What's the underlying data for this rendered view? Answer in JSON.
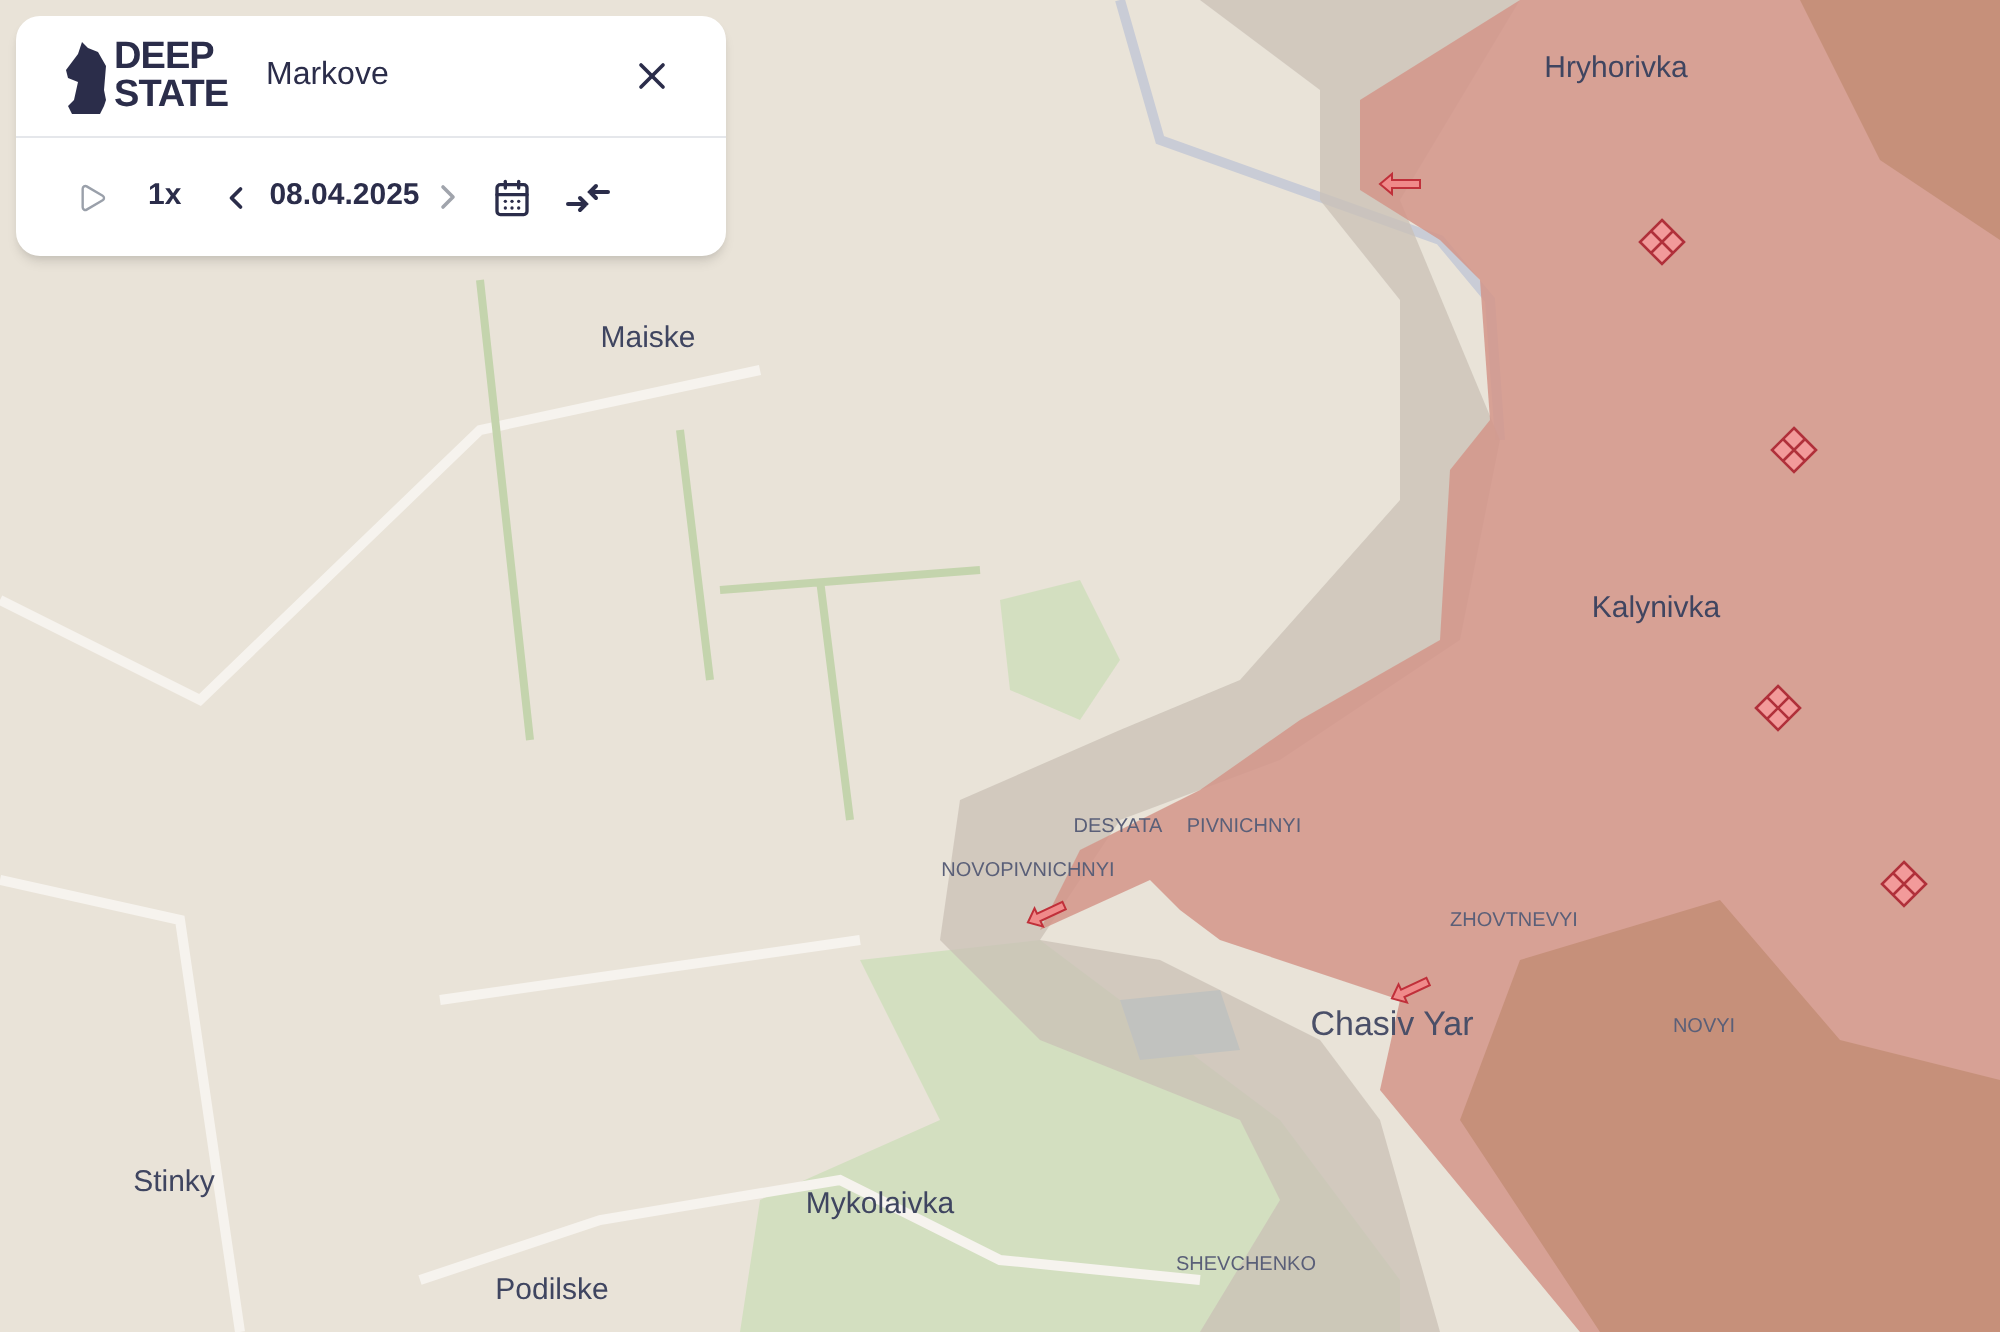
{
  "panel": {
    "logo_lines": [
      "DEEP",
      "STATE"
    ],
    "place": "Markove",
    "speed": "1x",
    "date": "08.04.2025",
    "prev_disabled": false,
    "next_disabled": true
  },
  "map_labels": [
    {
      "text": "Hryhorivka",
      "kind": "town"
    },
    {
      "text": "Maiske",
      "kind": "town"
    },
    {
      "text": "Kalynivka",
      "kind": "town"
    },
    {
      "text": "DESYATA",
      "kind": "district"
    },
    {
      "text": "PIVNICHNYI",
      "kind": "district"
    },
    {
      "text": "NOVOPIVNICHNYI",
      "kind": "district"
    },
    {
      "text": "ZHOVTNEVYI",
      "kind": "district"
    },
    {
      "text": "Chasiv Yar",
      "kind": "city"
    },
    {
      "text": "NOVYI",
      "kind": "district"
    },
    {
      "text": "Stinky",
      "kind": "town"
    },
    {
      "text": "Mykolaivka",
      "kind": "town"
    },
    {
      "text": "Podilske",
      "kind": "town"
    },
    {
      "text": "SHEVCHENKO",
      "kind": "district"
    }
  ]
}
